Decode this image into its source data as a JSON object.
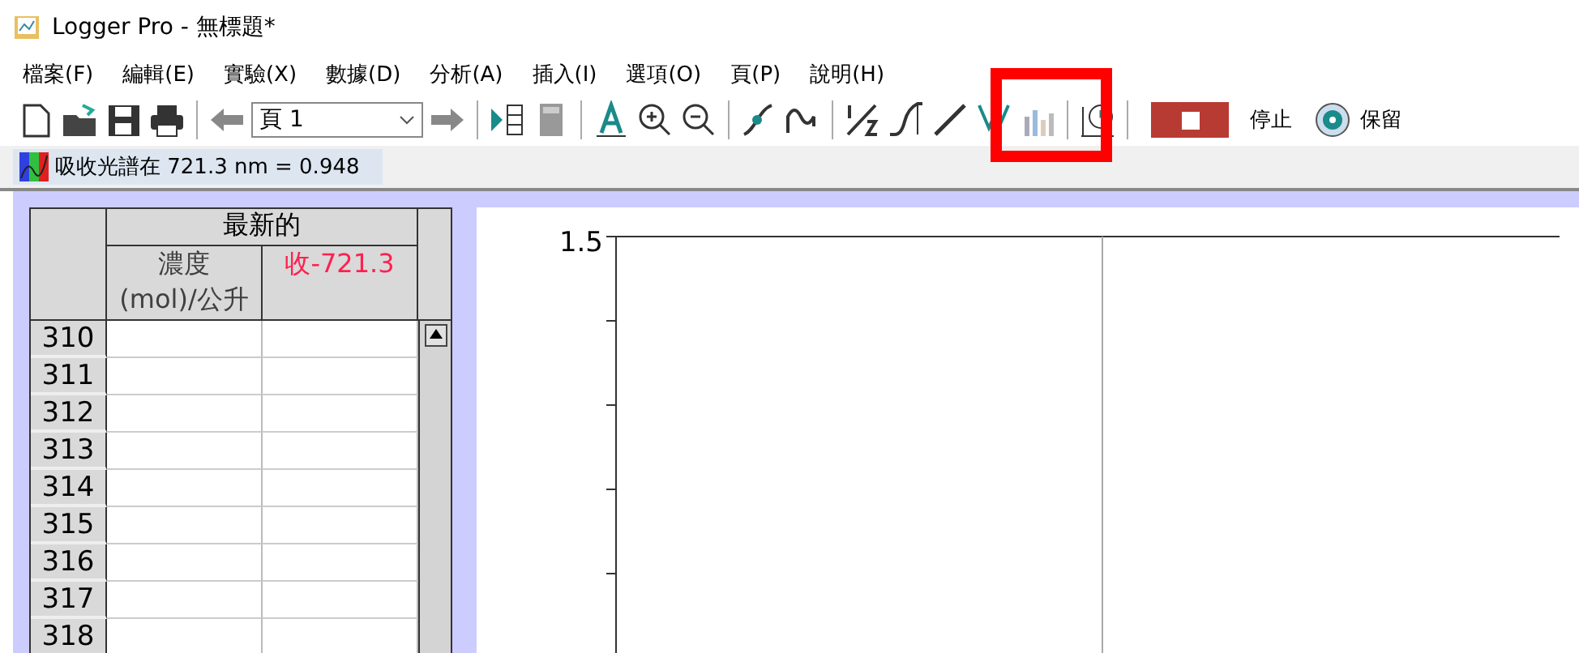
{
  "window": {
    "title": "Logger Pro - 無標題*"
  },
  "menu": [
    "檔案(F)",
    "編輯(E)",
    "實驗(X)",
    "數據(D)",
    "分析(A)",
    "插入(I)",
    "選項(O)",
    "頁(P)",
    "說明(H)"
  ],
  "toolbar": {
    "page_select": "頁 1",
    "stop_label": "停止",
    "keep_label": "保留"
  },
  "status": {
    "reading": "吸收光譜在 721.3 nm = 0.948"
  },
  "table": {
    "group_header": "最新的",
    "columns": [
      {
        "name": "濃度",
        "unit": "(mol)/公升",
        "color": "#404040"
      },
      {
        "name": "收-721.3",
        "color": "#ff2050"
      }
    ],
    "rows": [
      "310",
      "311",
      "312",
      "313",
      "314",
      "315",
      "316",
      "317",
      "318"
    ]
  },
  "graph": {
    "y_tick": "1.5"
  }
}
